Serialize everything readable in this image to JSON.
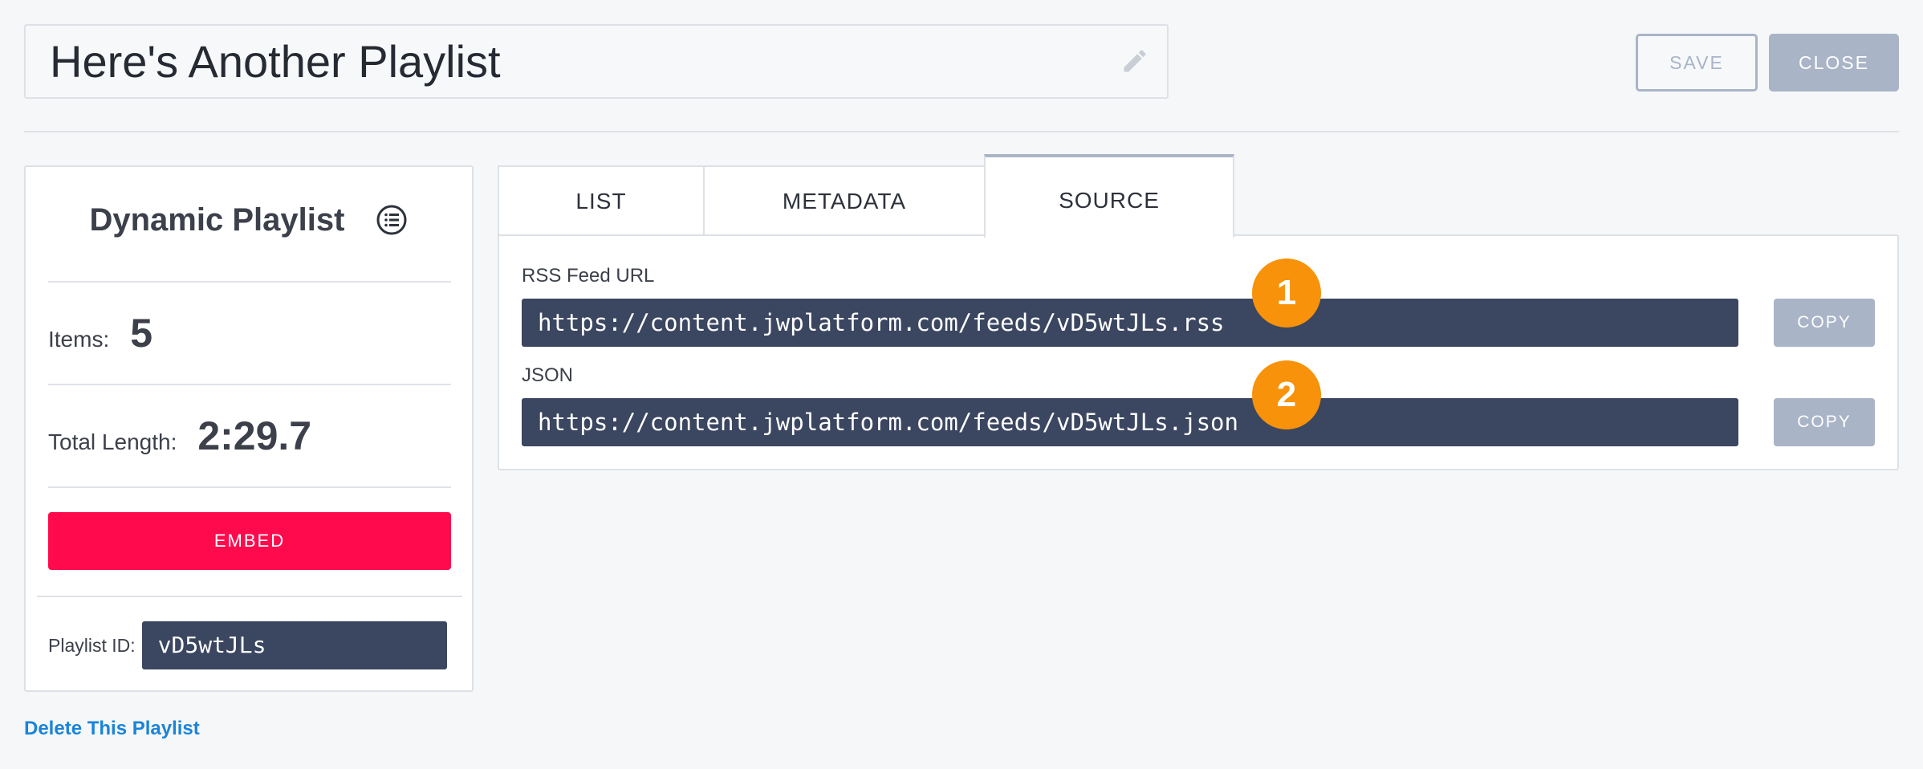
{
  "header": {
    "playlist_title": "Here's Another Playlist",
    "save_label": "SAVE",
    "close_label": "CLOSE"
  },
  "side_panel": {
    "title": "Dynamic Playlist",
    "items_label": "Items:",
    "items_value": "5",
    "length_label": "Total Length:",
    "length_value": "2:29.7",
    "embed_label": "EMBED",
    "id_label": "Playlist ID:",
    "id_value": "vD5wtJLs"
  },
  "delete_link": "Delete This Playlist",
  "tabs": [
    {
      "label": "LIST"
    },
    {
      "label": "METADATA"
    },
    {
      "label": "SOURCE",
      "active": true
    }
  ],
  "source": {
    "rss_label": "RSS Feed URL",
    "rss_url": "https://content.jwplatform.com/feeds/vD5wtJLs.rss",
    "json_label": "JSON",
    "json_url": "https://content.jwplatform.com/feeds/vD5wtJLs.json",
    "copy_label": "COPY"
  },
  "markers": [
    "1",
    "2"
  ],
  "colors": {
    "embed": "#ff0a4c",
    "marker": "#f7920a",
    "field_dark": "#3b4660",
    "muted_button": "#a9b4c7",
    "link": "#1a84d8"
  },
  "icons": [
    "pencil-icon",
    "list-circle-icon"
  ]
}
